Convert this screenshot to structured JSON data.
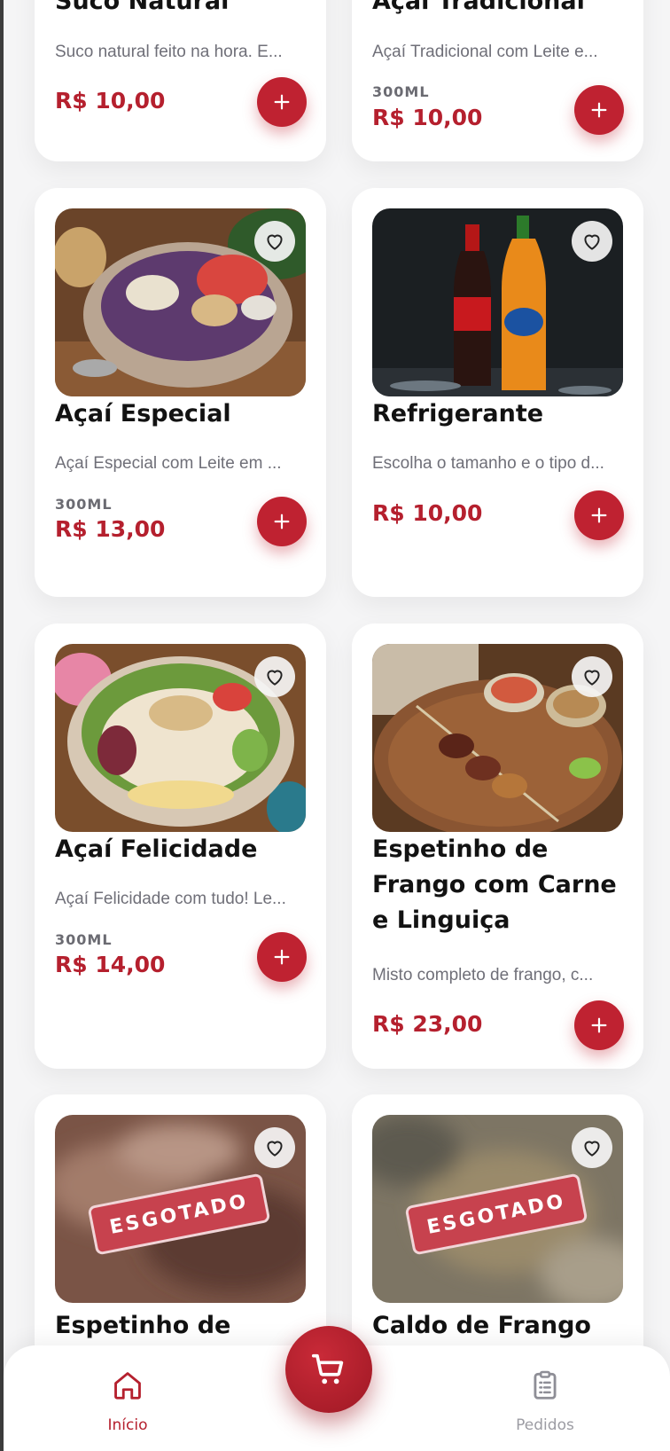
{
  "colors": {
    "accent": "#bf2231",
    "price": "#b5202e",
    "text": "#121212",
    "muted": "#6f6f78"
  },
  "products": [
    {
      "title": "Suco Natural",
      "description": "Suco natural feito na hora. E...",
      "size": "",
      "price": "R$ 10,00",
      "sold_out": false
    },
    {
      "title": "Açaí Tradicional",
      "description": "Açaí Tradicional com Leite e...",
      "size": "300ML",
      "price": "R$ 10,00",
      "sold_out": false
    },
    {
      "title": "Açaí Especial",
      "description": "Açaí Especial com Leite em ...",
      "size": "300ML",
      "price": "R$ 13,00",
      "sold_out": false
    },
    {
      "title": "Refrigerante",
      "description": "Escolha o tamanho e o tipo d...",
      "size": "",
      "price": "R$ 10,00",
      "sold_out": false
    },
    {
      "title": "Açaí Felicidade",
      "description": "Açaí Felicidade com tudo! Le...",
      "size": "300ML",
      "price": "R$ 14,00",
      "sold_out": false
    },
    {
      "title": "Espetinho de Frango com Carne e Linguiça",
      "description": "Misto completo de frango, c...",
      "size": "",
      "price": "R$ 23,00",
      "sold_out": false
    },
    {
      "title": "Espetinho de",
      "sold_out": true,
      "badge": "ESGOTADO"
    },
    {
      "title": "Caldo de Frango",
      "sold_out": true,
      "badge": "ESGOTADO"
    }
  ],
  "icons": {
    "favorite": "heart-outline-icon",
    "add": "plus-icon",
    "cart": "cart-icon",
    "home": "home-icon",
    "orders": "clipboard-list-icon"
  },
  "nav": {
    "home_label": "Início",
    "orders_label": "Pedidos",
    "active": "home"
  }
}
